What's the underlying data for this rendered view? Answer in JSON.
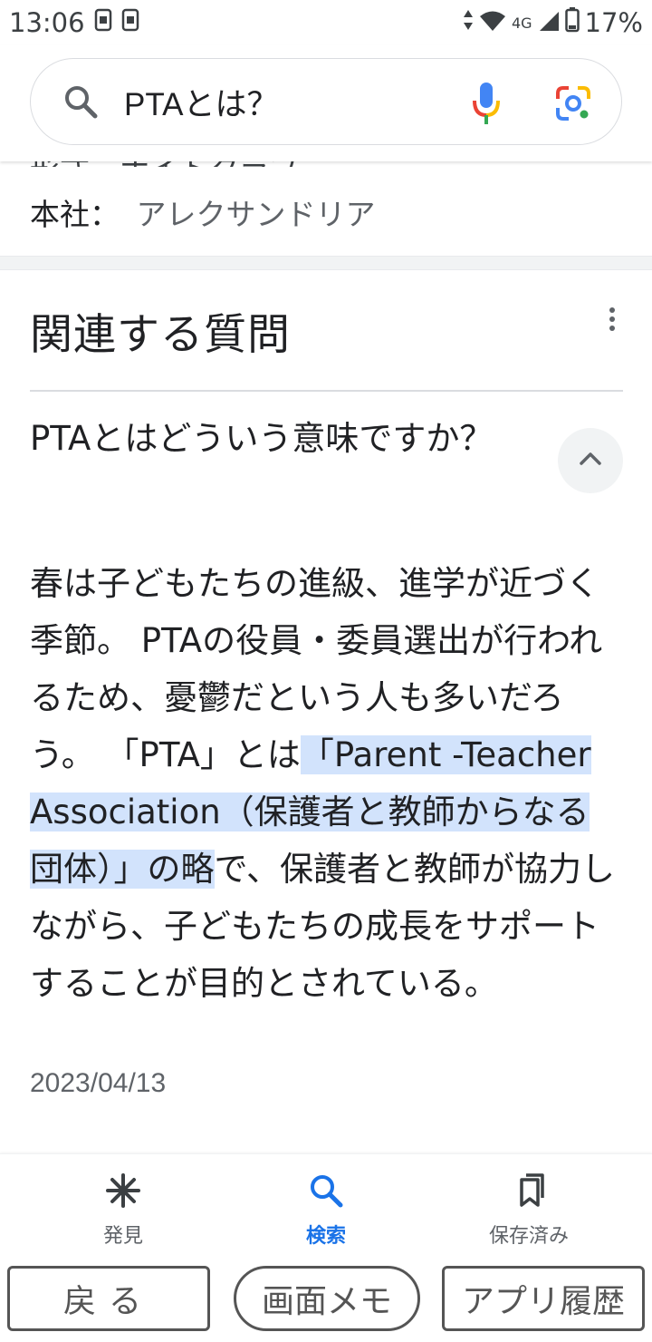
{
  "status_bar": {
    "time": "13:06",
    "network": "4G",
    "battery": "17%"
  },
  "search": {
    "query": "PTAとは？"
  },
  "knowledge_panel": {
    "partial_row": "形式　ナイトクラブ",
    "company_key": "本社：",
    "company_value": "アレクサンドリア"
  },
  "related_questions": {
    "title": "関連する質問",
    "question": "PTAとはどういう意味ですか？",
    "answer_part1": "春は子どもたちの進級、進学が近づく季節。 PTAの役員・委員選出が行われるため、憂鬱だという人も多いだろう。 「PTA」とは",
    "answer_highlight1": "「Parent -Teacher Association（保護者と教師からなる団体）」の略",
    "answer_part2": "で、保護者と教師が協力しながら、子どもたちの成長をサポートすることが目的とされている。",
    "date": "2023/04/13"
  },
  "bottom_nav": {
    "discover": "発見",
    "search": "検索",
    "saved": "保存済み",
    "active_color": "#1a73e8"
  },
  "system_buttons": {
    "back": "戻る",
    "memo": "画面メモ",
    "history": "アプリ履歴"
  }
}
